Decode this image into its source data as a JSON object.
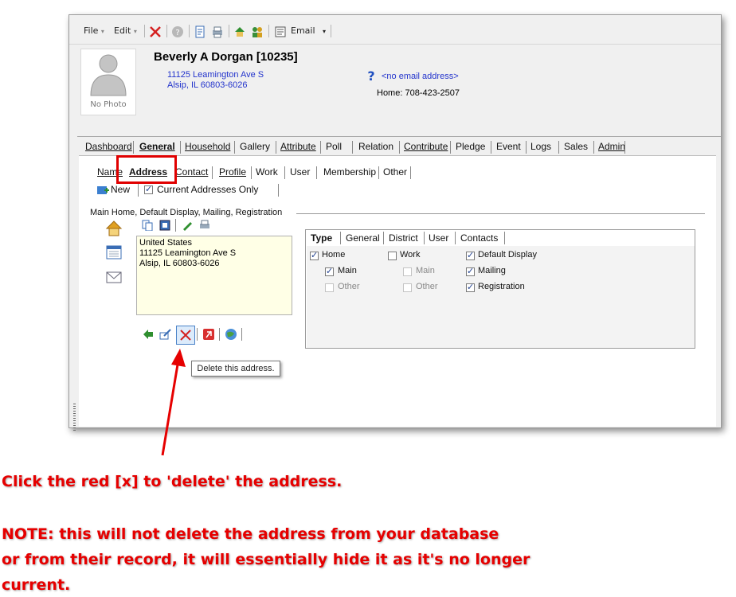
{
  "toolbar": {
    "file_label": "File",
    "edit_label": "Edit",
    "email_label": "Email",
    "icons": [
      "delete-icon",
      "help-icon",
      "report-icon",
      "print-icon",
      "home-icon",
      "people-icon",
      "email-icon"
    ]
  },
  "record": {
    "name": "Beverly A Dorgan  [10235]",
    "address_line1": "11125 Leamington Ave S",
    "address_line2": "Alsip, IL 60803-6026",
    "email": "<no email address>",
    "phone": "Home: 708-423-2507",
    "photo_label": "No Photo"
  },
  "main_tabs": [
    "Dashboard",
    "General",
    "Household",
    "Gallery",
    "Attribute",
    "Poll",
    "Relation",
    "Contribute",
    "Pledge",
    "Event",
    "Logs",
    "Sales",
    "Admin"
  ],
  "sub_tabs": [
    "Name",
    "Address",
    "Contact",
    "Profile",
    "Work",
    "User",
    "Membership",
    "Other"
  ],
  "address_bar": {
    "new_label": "New",
    "current_only_label": "Current Addresses Only",
    "current_only_checked": true
  },
  "group_title": "Main Home, Default Display, Mailing, Registration",
  "address_text": {
    "line1": "United States",
    "line2": "11125 Leamington Ave S",
    "line3": "Alsip, IL  60803-6026"
  },
  "type_tabs": [
    "Type",
    "General",
    "District",
    "User",
    "Contacts"
  ],
  "type_options": {
    "home": "Home",
    "work": "Work",
    "default_display": "Default Display",
    "home_main": "Main",
    "work_main": "Main",
    "mailing": "Mailing",
    "home_other": "Other",
    "work_other": "Other",
    "registration": "Registration"
  },
  "tooltip": "Delete this address.",
  "instructions": {
    "line1": "Click the red [x] to 'delete' the address.",
    "line2": "NOTE: this will not delete the address from your database",
    "line3": "or from their record, it will essentially hide it as it's no longer",
    "line4": "current."
  },
  "colors": {
    "accent_red": "#e60000",
    "link_blue": "#2233cc"
  }
}
